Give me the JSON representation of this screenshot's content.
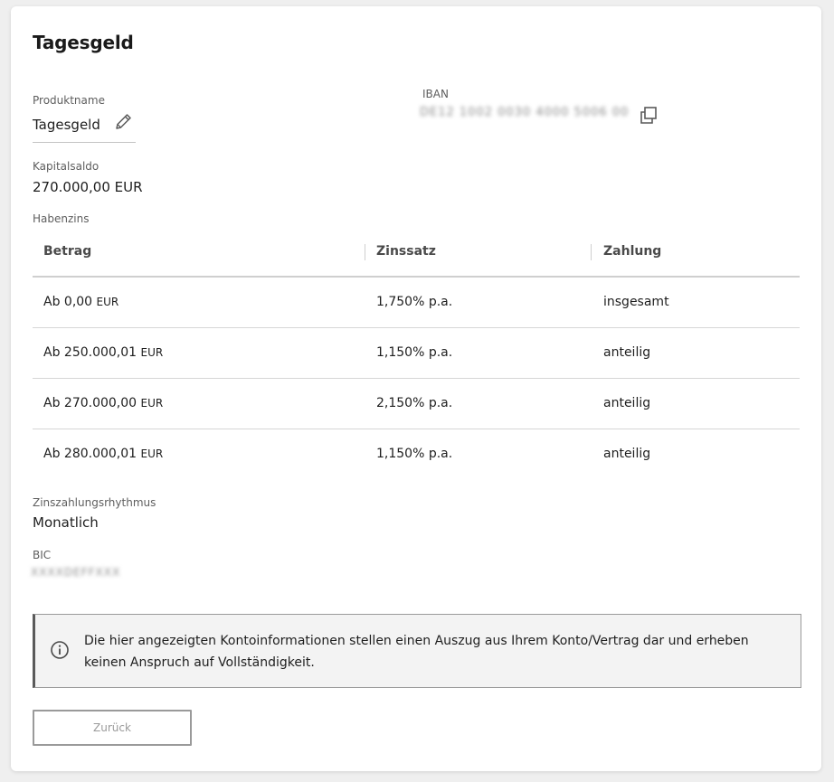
{
  "page": {
    "title": "Tagesgeld"
  },
  "product": {
    "label": "Produktname",
    "value": "Tagesgeld"
  },
  "iban": {
    "label": "IBAN",
    "value": "DE12 1002 0030 4000 5006 00"
  },
  "capital": {
    "label": "Kapitalsaldo",
    "value": "270.000,00 EUR"
  },
  "interest": {
    "label": "Habenzins",
    "headers": {
      "amount": "Betrag",
      "rate": "Zinssatz",
      "payment": "Zahlung"
    },
    "rows": [
      {
        "amount": "Ab 0,00",
        "currency": "EUR",
        "rate": "1,750% p.a.",
        "payment": "insgesamt"
      },
      {
        "amount": "Ab 250.000,01",
        "currency": "EUR",
        "rate": "1,150% p.a.",
        "payment": "anteilig"
      },
      {
        "amount": "Ab 270.000,00",
        "currency": "EUR",
        "rate": "2,150% p.a.",
        "payment": "anteilig"
      },
      {
        "amount": "Ab 280.000,01",
        "currency": "EUR",
        "rate": "1,150% p.a.",
        "payment": "anteilig"
      }
    ]
  },
  "rhythm": {
    "label": "Zinszahlungsrhythmus",
    "value": "Monatlich"
  },
  "bic": {
    "label": "BIC",
    "value": "XXXXDEFFXXX"
  },
  "notice": {
    "text": "Die hier angezeigten Kontoinformationen stellen einen Auszug aus Ihrem Konto/Vertrag dar und erheben keinen Anspruch auf Vollständigkeit."
  },
  "actions": {
    "back_label": "Zurück"
  },
  "icons": {
    "edit": "pencil-icon",
    "copy": "copy-icon",
    "info": "info-icon"
  }
}
